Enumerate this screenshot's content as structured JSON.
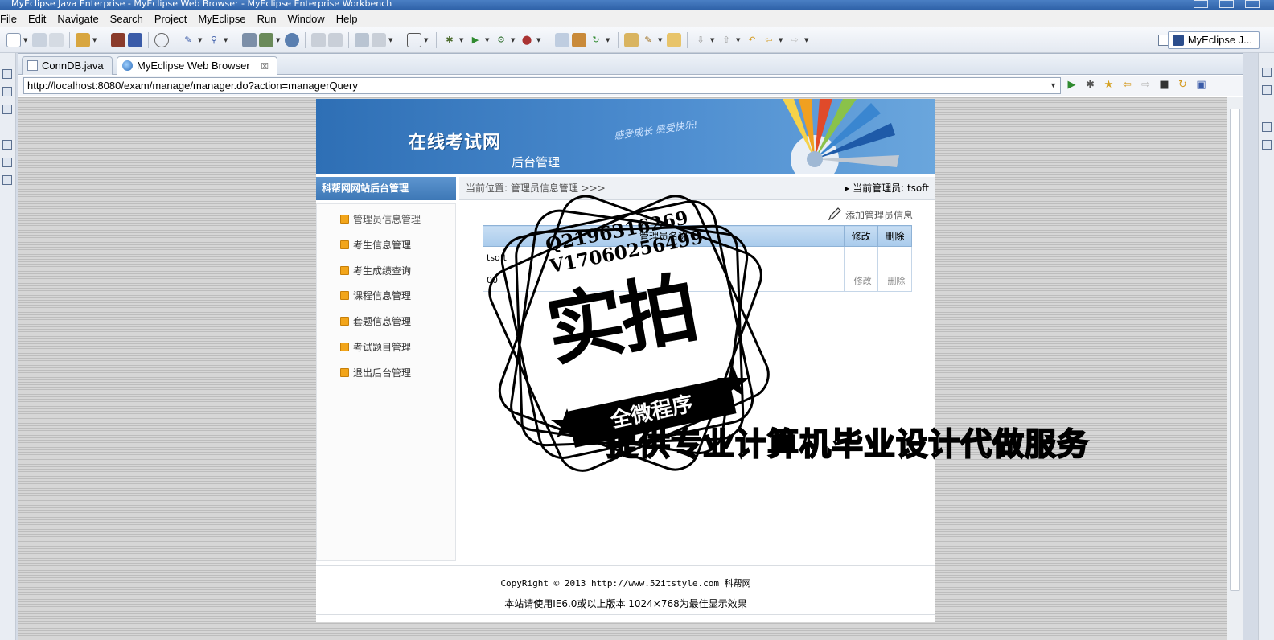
{
  "window": {
    "title": "MyEclipse Java Enterprise - MyEclipse Web Browser - MyEclipse Enterprise Workbench"
  },
  "menubar": {
    "items": [
      "File",
      "Edit",
      "Navigate",
      "Search",
      "Project",
      "MyEclipse",
      "Run",
      "Window",
      "Help"
    ]
  },
  "toolbar": {
    "perspective_label": "MyEclipse J..."
  },
  "tabs": [
    {
      "label": "ConnDB.java"
    },
    {
      "label": "MyEclipse Web Browser",
      "close": "☒"
    }
  ],
  "browser": {
    "url": "http://localhost:8080/exam/manage/manager.do?action=managerQuery"
  },
  "site": {
    "banner_title": "在线考试网",
    "banner_subtitle": "后台管理",
    "banner_slogan": "感受成长 感受快乐!",
    "side_header": "科帮网网站后台管理",
    "breadcrumb": "当前位置: 管理员信息管理 >>>",
    "current_admin": "当前管理员: tsoft",
    "menu": [
      "管理员信息管理",
      "考生信息管理",
      "考生成绩查询",
      "课程信息管理",
      "套题信息管理",
      "考试题目管理",
      "退出后台管理"
    ],
    "add_link": "添加管理员信息",
    "table": {
      "headers": [
        "管理员名称",
        "修改",
        "删除"
      ],
      "rows": [
        {
          "name": "tsoft",
          "edit": "",
          "delete": ""
        },
        {
          "name": "00",
          "edit": "修改",
          "delete": "删除"
        }
      ]
    },
    "footer_line1": "CopyRight © 2013 http://www.52itstyle.com 科帮网",
    "footer_line2": "本站请使用IE6.0或以上版本 1024×768为最佳显示效果"
  },
  "watermark": {
    "qq": "Q2196316269",
    "wechat": "V17060256499",
    "big": "实拍",
    "ribbon": "全微程序",
    "service": "提供专业计算机毕业设计代做服务"
  }
}
